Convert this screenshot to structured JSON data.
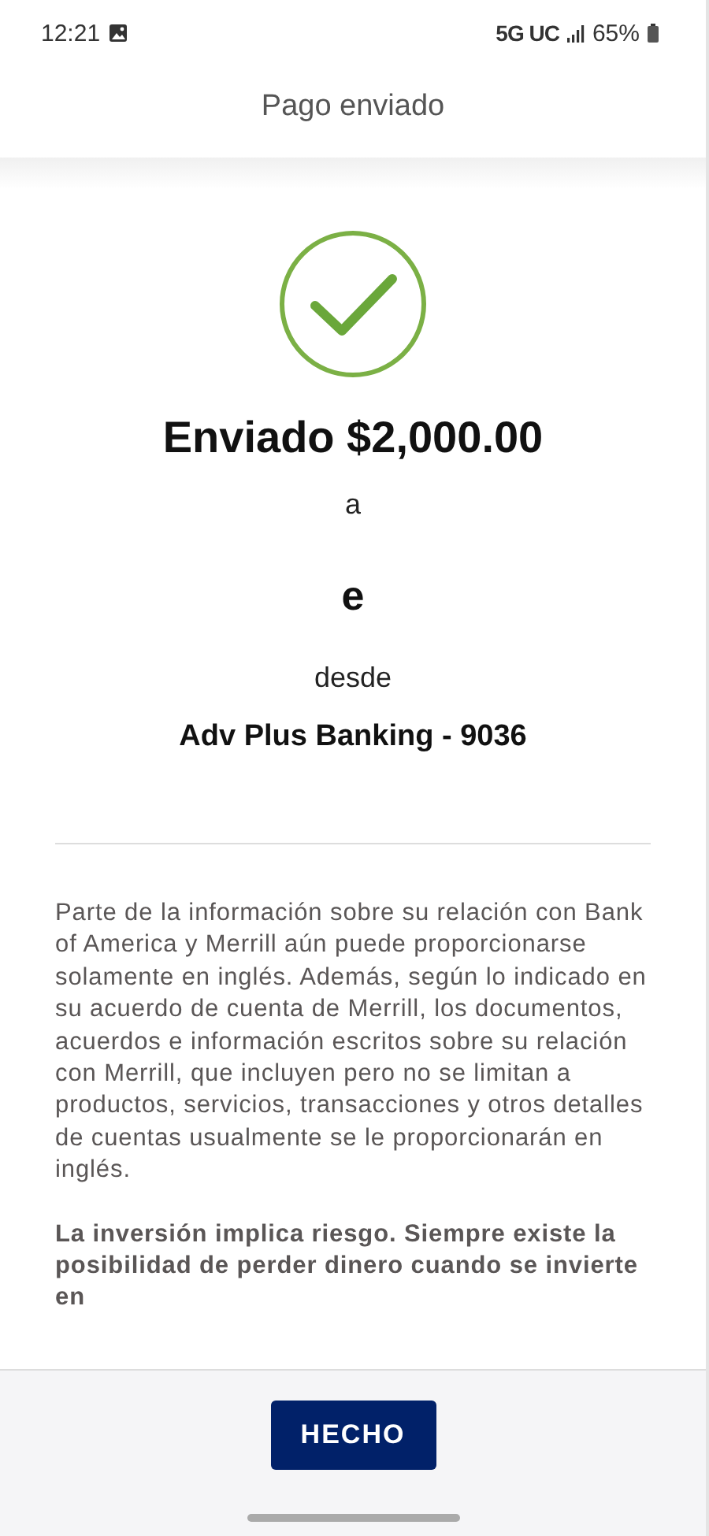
{
  "status_bar": {
    "time": "12:21",
    "network": "5G UC",
    "battery": "65%"
  },
  "header": {
    "title": "Pago enviado"
  },
  "confirmation": {
    "success": true,
    "amount_line": "Enviado $2,000.00",
    "to_label": "a",
    "recipient": "e",
    "from_label": "desde",
    "account": "Adv Plus Banking - 9036"
  },
  "disclosures": [
    {
      "kind": "regular",
      "text": "Parte de la información sobre su relación con Bank of America y Merrill aún puede proporcionarse solamente en inglés. Además, según lo indicado en su acuerdo de cuenta de Merrill, los documentos, acuerdos e información escritos sobre su relación con Merrill, que incluyen pero no se limitan a productos, servicios, transacciones y otros detalles de cuentas usualmente se le proporcionarán en inglés."
    },
    {
      "kind": "bold",
      "text": "La inversión implica riesgo. Siempre existe la posibilidad de perder dinero cuando se invierte en"
    }
  ],
  "footer": {
    "button": "HECHO"
  }
}
